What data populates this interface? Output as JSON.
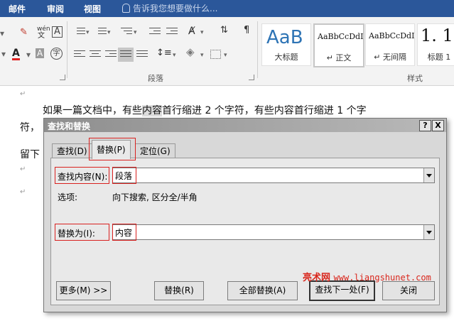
{
  "ribbon_tabs": [
    "邮件",
    "审阅",
    "视图"
  ],
  "tell_me": "告诉我您想要做什么...",
  "font_tools": {
    "phonetic": "wén",
    "char_border": "A",
    "font_color": "A",
    "char_shading": "A",
    "enclose_char": "字"
  },
  "groups": {
    "paragraph": "段落",
    "styles": "样式"
  },
  "styles": [
    {
      "preview": "AaB",
      "name": "大标题"
    },
    {
      "preview": "AaBbCcDdI",
      "name": "↵ 正文"
    },
    {
      "preview": "AaBbCcDdI",
      "name": "↵ 无间隔"
    },
    {
      "preview": "1. 1",
      "name": "标题 1"
    }
  ],
  "document": {
    "line1_pre": "如果一篇文档中，有些",
    "line1_hl": "内容",
    "line1_post": "首行缩进 2 个字符，有些内容首行缩进 1 个字",
    "line2": "符，",
    "line3": "留下",
    "para_mark": "↵"
  },
  "dialog": {
    "title": "查找和替换",
    "help": "?",
    "close": "X",
    "tabs": [
      "查找(D)",
      "替换(P)",
      "定位(G)"
    ],
    "find_label": "查找内容(N):",
    "find_value": "段落",
    "options_label": "选项:",
    "options_value": "向下搜索, 区分全/半角",
    "replace_label": "替换为(I):",
    "replace_value": "内容",
    "buttons": {
      "more": "更多(M) >>",
      "replace": "替换(R)",
      "replace_all": "全部替换(A)",
      "find_next": "查找下一处(F)",
      "close": "关闭"
    }
  },
  "watermark": {
    "site": "亮术网",
    "url": "www.liangshunet.com"
  },
  "colors": {
    "ribbon_tab_bar": "#2b579a",
    "highlight_frame": "#d9211f",
    "watermark": "#d9261c"
  }
}
